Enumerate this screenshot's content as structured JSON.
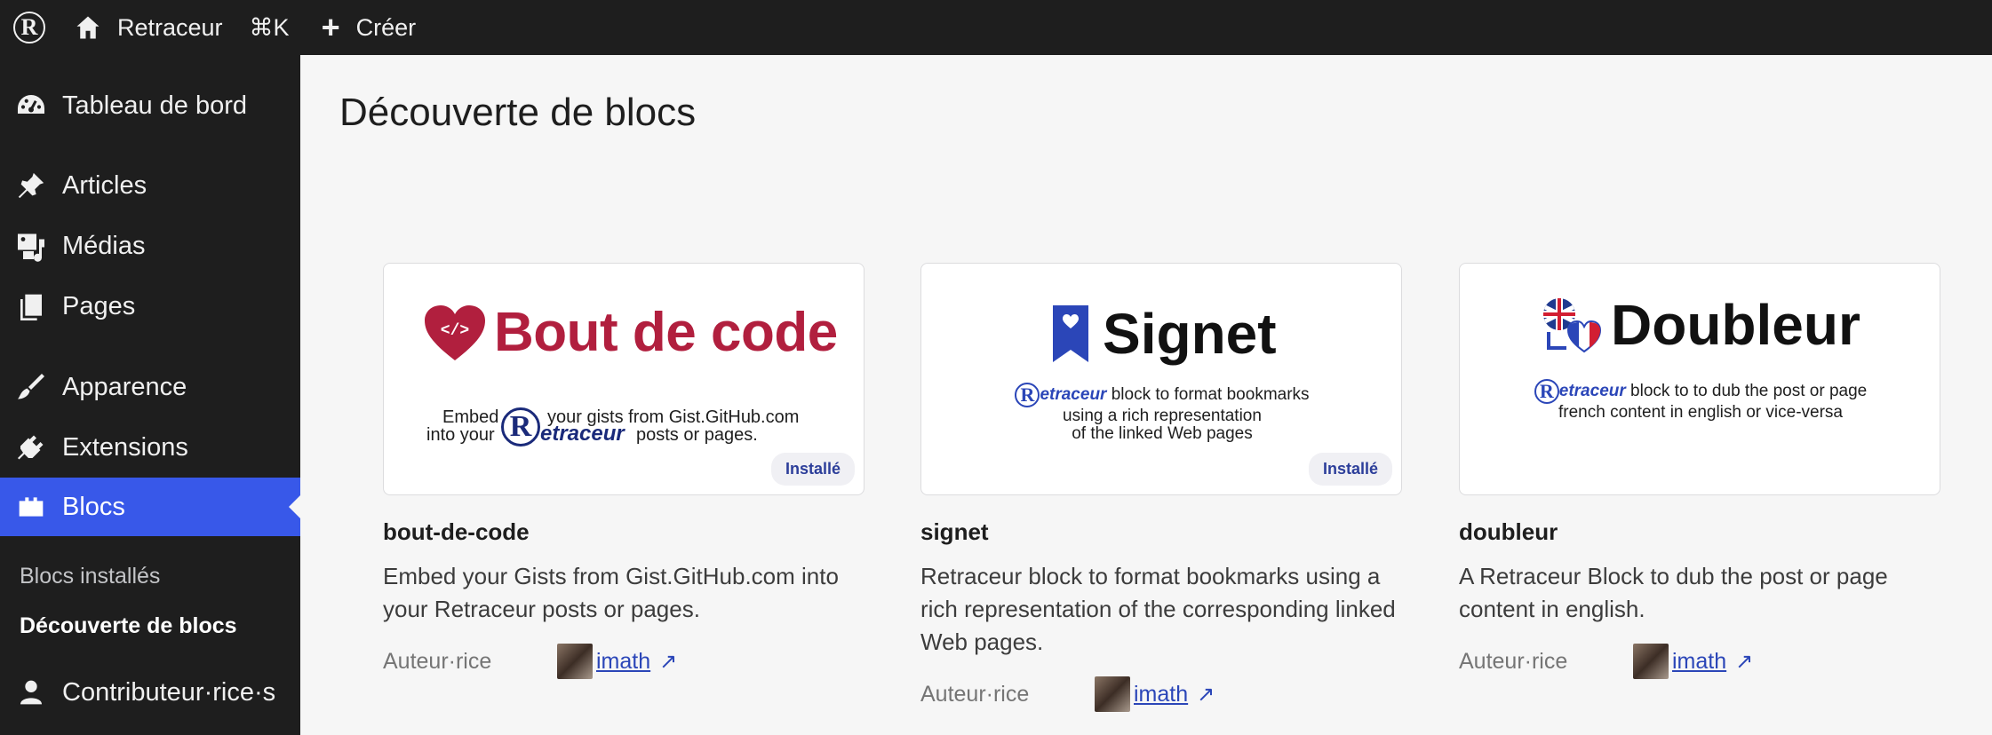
{
  "topbar": {
    "logo_letter": "R",
    "site_name": "Retraceur",
    "command_shortcut": "⌘K",
    "create_label": "Créer"
  },
  "sidebar": {
    "items": [
      {
        "label": "Tableau de bord",
        "icon": "dashboard-icon"
      },
      {
        "label": "Articles",
        "icon": "pin-icon"
      },
      {
        "label": "Médias",
        "icon": "media-icon"
      },
      {
        "label": "Pages",
        "icon": "pages-icon"
      },
      {
        "label": "Apparence",
        "icon": "brush-icon"
      },
      {
        "label": "Extensions",
        "icon": "plug-icon"
      },
      {
        "label": "Blocs",
        "icon": "blocks-icon",
        "active": true
      },
      {
        "label": "Contributeur·rice·s",
        "icon": "user-icon"
      }
    ],
    "submenu": [
      "Blocs installés",
      "Découverte de blocs"
    ]
  },
  "page": {
    "title": "Découverte de blocs"
  },
  "cards": [
    {
      "slug": "bout-de-code",
      "banner_title": "Bout de code",
      "banner_code_symbol": "</>",
      "banner_line1_a": "Embed",
      "banner_line1_b": "your gists from Gist.GitHub.com",
      "banner_line2_a": "into your",
      "banner_brand": "etraceur",
      "banner_line2_b": "posts or pages.",
      "badge": "Installé",
      "description": "Embed your Gists from Gist.GitHub.com into your Retraceur posts or pages.",
      "author_label": "Auteur·rice",
      "author": "imath"
    },
    {
      "slug": "signet",
      "banner_title": "Signet",
      "banner_brand": "etraceur",
      "banner_line1": "block to format bookmarks",
      "banner_line2": "using a rich representation",
      "banner_line3": "of the linked Web pages",
      "badge": "Installé",
      "description": "Retraceur block to format bookmarks using a rich representation of the corresponding linked Web pages.",
      "author_label": "Auteur·rice",
      "author": "imath"
    },
    {
      "slug": "doubleur",
      "banner_title": "Doubleur",
      "banner_brand": "etraceur",
      "banner_line1": "block to  to dub the post or page",
      "banner_line2": "french content in english or vice-versa",
      "description": "A Retraceur Block to dub the post or page content in english.",
      "author_label": "Auteur·rice",
      "author": "imath"
    }
  ],
  "colors": {
    "admin_bg": "#1e1e1e",
    "accent": "#3858e9",
    "bout_de_code_red": "#b11f3e",
    "link": "#2b46b8"
  }
}
